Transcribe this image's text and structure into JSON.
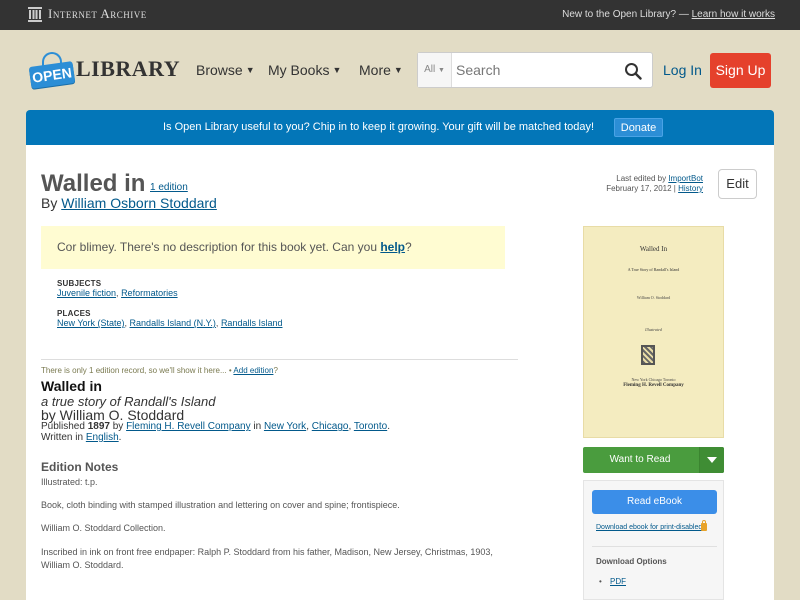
{
  "ia_bar": {
    "logo_text": "Internet Archive",
    "right_text": "New to the Open Library? —",
    "right_link": "Learn how it works"
  },
  "header": {
    "logo_badge": "OPEN",
    "logo_word": "LIBRARY",
    "nav": [
      {
        "label": "Browse"
      },
      {
        "label": "My Books"
      },
      {
        "label": "More"
      }
    ],
    "search_category": "All",
    "search_placeholder": "Search",
    "login": "Log In",
    "signup": "Sign Up"
  },
  "donate": {
    "text": "Is Open Library useful to you? Chip in to keep it growing. Your gift will be matched today!",
    "button": "Donate"
  },
  "work": {
    "title": "Walled in",
    "edition_count": "1 edition",
    "by": "By",
    "author": "William Osborn Stoddard",
    "last_edited_label": "Last edited by",
    "last_edited_by": "ImportBot",
    "last_edited_date": "February 17, 2012",
    "history": "History",
    "edit": "Edit",
    "no_desc_text": "Cor blimey. There's no description for this book yet. Can you",
    "no_desc_link": "help",
    "no_desc_end": "?",
    "subjects_heading": "SUBJECTS",
    "subjects": [
      "Juvenile fiction",
      "Reformatories"
    ],
    "places_heading": "PLACES",
    "places": [
      "New York (State)",
      "Randalls Island (N.Y.)",
      "Randalls Island"
    ]
  },
  "edition": {
    "note": "There is only 1 edition record, so we'll show it here... •",
    "add_edition": "Add edition",
    "add_edition_end": "?",
    "title": "Walled in",
    "subtitle": "a true story of Randall's Island",
    "by": "by William O. Stoddard",
    "published_label": "Published",
    "year": "1897",
    "by_word": "by",
    "publisher": "Fleming H. Revell Company",
    "in_word": "in",
    "places": [
      "New York",
      "Chicago",
      "Toronto"
    ],
    "written_in": "Written in",
    "language": "English",
    "notes_heading": "Edition Notes",
    "notes": [
      "Illustrated: t.p.",
      "Book, cloth binding with stamped illustration and lettering on cover and spine; frontispiece.",
      "William O. Stoddard Collection.",
      "Inscribed in ink on front free endpaper: Ralph P. Stoddard from his father, Madison, New Jersey, Christmas, 1903, William O. Stoddard."
    ]
  },
  "cover": {
    "title": "Walled In",
    "subtitle": "A True Story of Randall's Island",
    "author": "William O. Stoddard",
    "illustrated": "Illustrated",
    "publisher": "Fleming H. Revell Company",
    "cities": "New York   Chicago   Toronto"
  },
  "sidebar": {
    "want_to_read": "Want to Read",
    "read_ebook": "Read eBook",
    "download_disabled": "Download ebook for print-disabled",
    "download_options": "Download Options",
    "download_items": [
      "PDF"
    ]
  }
}
